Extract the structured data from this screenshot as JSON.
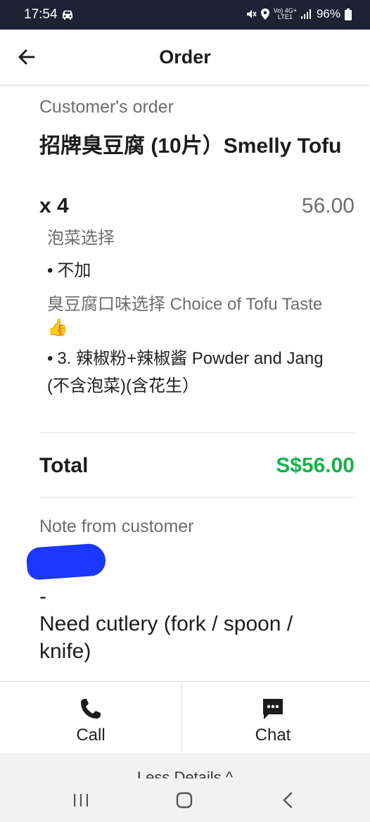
{
  "status_bar": {
    "time": "17:54",
    "network_top": "Vo) 4G+",
    "network_bottom": "LTE1",
    "battery": "96%"
  },
  "header": {
    "title": "Order"
  },
  "order": {
    "section_label": "Customer's order",
    "item_name": "招牌臭豆腐 (10片）Smelly Tofu",
    "quantity": "x 4",
    "price": "56.00",
    "options": [
      {
        "label": "泡菜选择",
        "value": "不加"
      },
      {
        "label": "臭豆腐口味选择  Choice of Tofu Taste👍",
        "value": "3. 辣椒粉+辣椒酱 Powder and Jang (不含泡菜)(含花生）"
      }
    ]
  },
  "total": {
    "label": "Total",
    "value": "S$56.00"
  },
  "note": {
    "label": "Note from customer",
    "line1": "-",
    "line2": "Need cutlery (fork / spoon / knife)"
  },
  "actions": {
    "call_label": "Call",
    "chat_label": "Chat"
  },
  "details_toggle": {
    "label": "Less Details ^"
  },
  "colors": {
    "status_bar_bg": "#1f2235",
    "total_green": "#17b14a",
    "muted_gray": "#6d6d6d",
    "redaction_blue": "#1c37ff"
  }
}
